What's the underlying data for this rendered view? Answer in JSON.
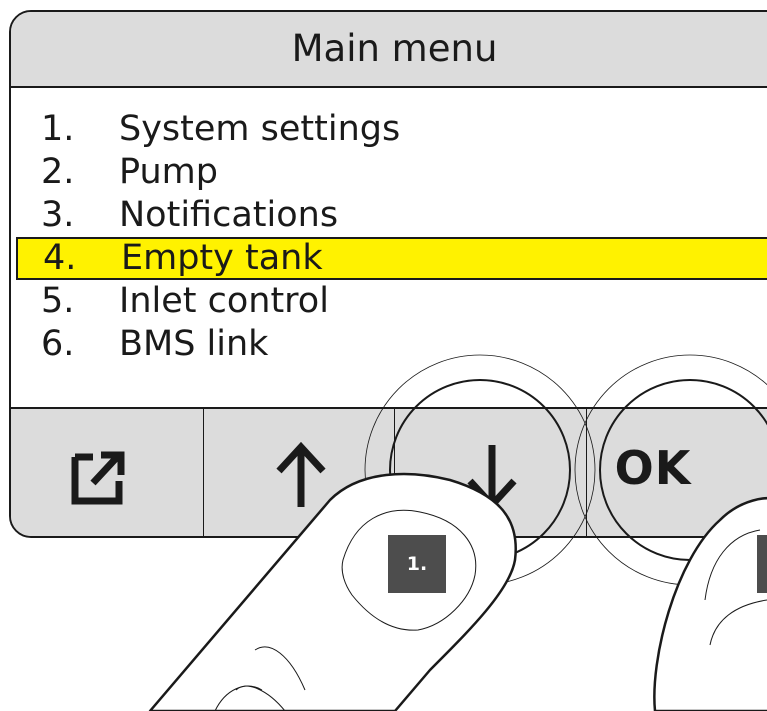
{
  "header": {
    "title": "Main menu"
  },
  "menu": {
    "items": [
      {
        "number": "1.",
        "label": "System settings",
        "selected": false
      },
      {
        "number": "2.",
        "label": "Pump",
        "selected": false
      },
      {
        "number": "3.",
        "label": "Notifications",
        "selected": false
      },
      {
        "number": "4.",
        "label": "Empty tank",
        "selected": true
      },
      {
        "number": "5.",
        "label": "Inlet control",
        "selected": false
      },
      {
        "number": "6.",
        "label": "BMS link",
        "selected": false
      }
    ]
  },
  "buttons": {
    "back_icon": "exit-arrow-icon",
    "up_icon": "arrow-up-icon",
    "down_icon": "arrow-down-icon",
    "ok_label": "OK"
  },
  "steps": {
    "first": "1."
  },
  "colors": {
    "highlight": "#fff200",
    "bar_background": "#dcdcdc",
    "outline": "#1a1a1a",
    "badge": "#4d4d4d"
  }
}
